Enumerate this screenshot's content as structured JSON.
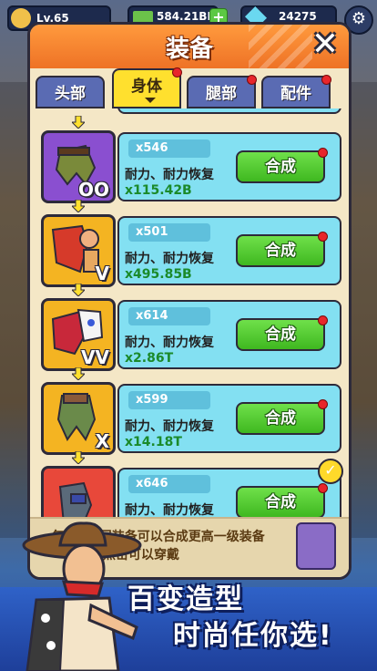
{
  "hud": {
    "level": "Lv.65",
    "cash": "584.21BB",
    "gems": "24275"
  },
  "panel": {
    "title": "装备",
    "close_symbol": "✕"
  },
  "tabs": [
    {
      "label": "头部",
      "active": false,
      "badge": false
    },
    {
      "label": "身体",
      "active": true,
      "badge": true
    },
    {
      "label": "腿部",
      "active": false,
      "badge": true
    },
    {
      "label": "配件",
      "active": false,
      "badge": true
    }
  ],
  "items": [
    {
      "rank": "OO",
      "count": "x546",
      "attribute": "耐力、耐力恢复",
      "value": "x115.42B",
      "button": "合成",
      "color": "#8a4fd0",
      "badge": true
    },
    {
      "rank": "V",
      "count": "x501",
      "attribute": "耐力、耐力恢复",
      "value": "x495.85B",
      "button": "合成",
      "color": "#f4b422",
      "badge": true
    },
    {
      "rank": "VV",
      "count": "x614",
      "attribute": "耐力、耐力恢复",
      "value": "x2.86T",
      "button": "合成",
      "color": "#f4b422",
      "badge": true
    },
    {
      "rank": "X",
      "count": "x599",
      "attribute": "耐力、耐力恢复",
      "value": "x14.18T",
      "button": "合成",
      "color": "#f4b422",
      "badge": true
    },
    {
      "rank": "",
      "count": "x646",
      "attribute": "耐力、耐力恢复",
      "value": "",
      "button": "合成",
      "color": "#e8483a",
      "badge": true
    }
  ],
  "footer": {
    "line1": "每5件相同装备可以合成更高一级装备",
    "line2": "点击可以穿戴"
  },
  "banner": {
    "slogan1": "百变造型",
    "slogan2": "时尚任你选!"
  },
  "colors": {
    "header": "#ee7226",
    "card": "#83e0f2",
    "button": "#3fb820",
    "tab": "#5a6bb3",
    "tab_active": "#ffe02e"
  }
}
